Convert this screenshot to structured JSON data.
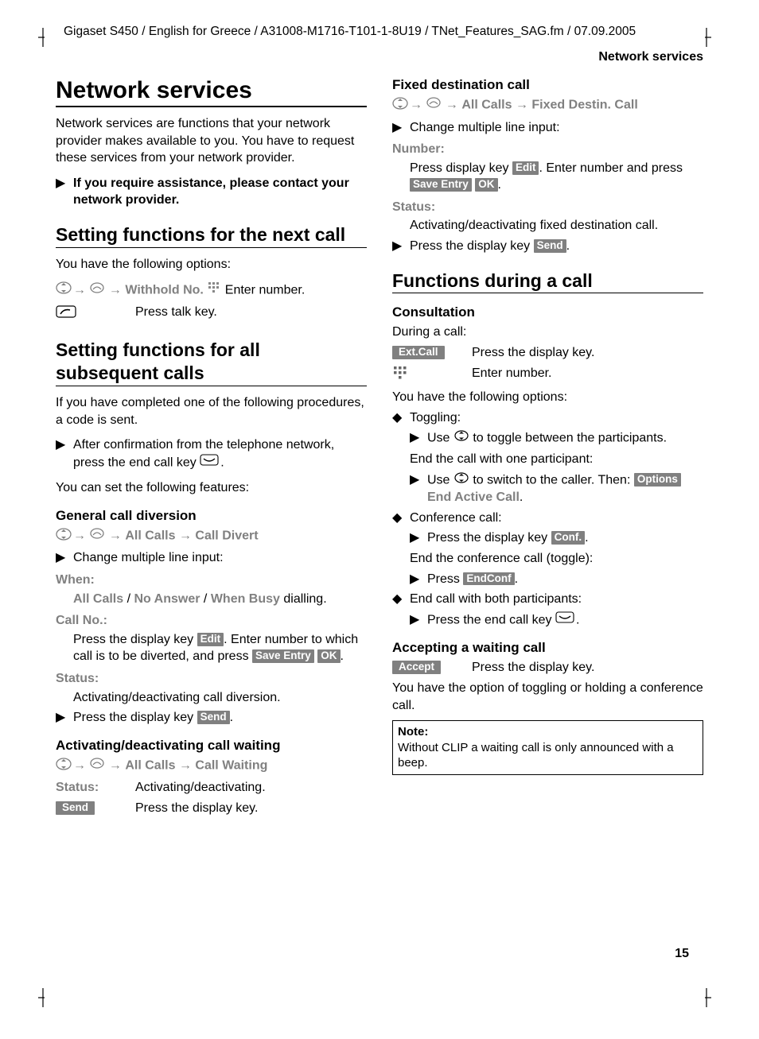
{
  "meta": {
    "header_line": "Gigaset S450 / English for Greece / A31008-M1716-T101-1-8U19 / TNet_Features_SAG.fm / 07.09.2005",
    "running_head": "Network services",
    "page_number": "15"
  },
  "left": {
    "title": "Network services",
    "intro": "Network services are functions that your network provider makes available to you. You have to request these services from your network provider.",
    "assist_bullet": "If you require assistance, please contact your network provider.",
    "sec_next_call": "Setting functions for the next call",
    "next_call_intro": "You have the following options:",
    "withhold_label": "Withhold No.",
    "enter_number": "Enter number.",
    "press_talk": "Press talk key.",
    "sec_subsequent": "Setting functions for all subsequent calls",
    "subseq_intro": "If you have completed one of the following procedures, a code is sent.",
    "after_confirm_pre": "After confirmation from the telephone network, press the end call key ",
    "after_confirm_post": ".",
    "set_features": "You can set the following features:",
    "h_gcd": "General call diversion",
    "all_calls": "All Calls",
    "call_divert": "Call Divert",
    "change_multi": "Change multiple line input:",
    "when_label": "When:",
    "when_line_all": "All Calls",
    "when_line_noans": "No Answer",
    "when_line_busy": "When Busy",
    "when_line_tail": " dialling.",
    "callno_label": "Call No.:",
    "callno_text_pre": "Press the display key ",
    "callno_text_mid": ". Enter number to which call is to be diverted, and press ",
    "callno_text_post": ".",
    "edit_key": "Edit",
    "save_key": "Save Entry",
    "ok_key": "OK",
    "status_label": "Status:",
    "status_gcd": "Activating/deactivating call diversion.",
    "press_send_pre": "Press the display key ",
    "press_send_post": ".",
    "send_key": "Send",
    "h_cw": "Activating/deactivating call waiting",
    "cw_label": "Call Waiting",
    "cw_status": "Activating/deactivating.",
    "cw_press": "Press the display key."
  },
  "right": {
    "h_fdc": "Fixed destination call",
    "fdc_label": "Fixed Destin. Call",
    "change_multi": "Change multiple line input:",
    "number_label": "Number:",
    "fdc_num_pre": "Press display key ",
    "fdc_num_mid": ". Enter number and press ",
    "fdc_num_post": ".",
    "status_label": "Status:",
    "fdc_status": "Activating/deactivating fixed destination call.",
    "press_send_pre": "Press the display key ",
    "press_send_post": ".",
    "sec_during": "Functions during a call",
    "h_consult": "Consultation",
    "during_call": "During a call:",
    "extcall_key": "Ext.Call",
    "press_display": "Press the display key.",
    "enter_number": "Enter number.",
    "options_intro": "You have the following options:",
    "toggling": "Toggling:",
    "toggle_use_pre": "Use ",
    "toggle_use_post": " to toggle between the participants.",
    "end_one": "End the call with one participant:",
    "switch_pre": "Use ",
    "switch_mid": " to switch to the caller. Then: ",
    "end_active": "End Active Call",
    "options_key": "Options",
    "conf_head": "Conference call:",
    "conf_press_pre": "Press the display key ",
    "conf_press_post": ".",
    "conf_key": "Conf.",
    "conf_end_toggle": "End the conference call (toggle):",
    "press_pre": "Press ",
    "press_post": ".",
    "endconf_key": "EndConf",
    "end_both": "End call with both participants:",
    "end_call_pre": "Press the end call key ",
    "end_call_post": ".",
    "h_accept": "Accepting a waiting call",
    "accept_key": "Accept",
    "accept_text": "Press the display key.",
    "accept_option": "You have the option of toggling or holding a conference call.",
    "note_title": "Note:",
    "note_body": "Without CLIP a waiting call is only announced with a beep."
  }
}
